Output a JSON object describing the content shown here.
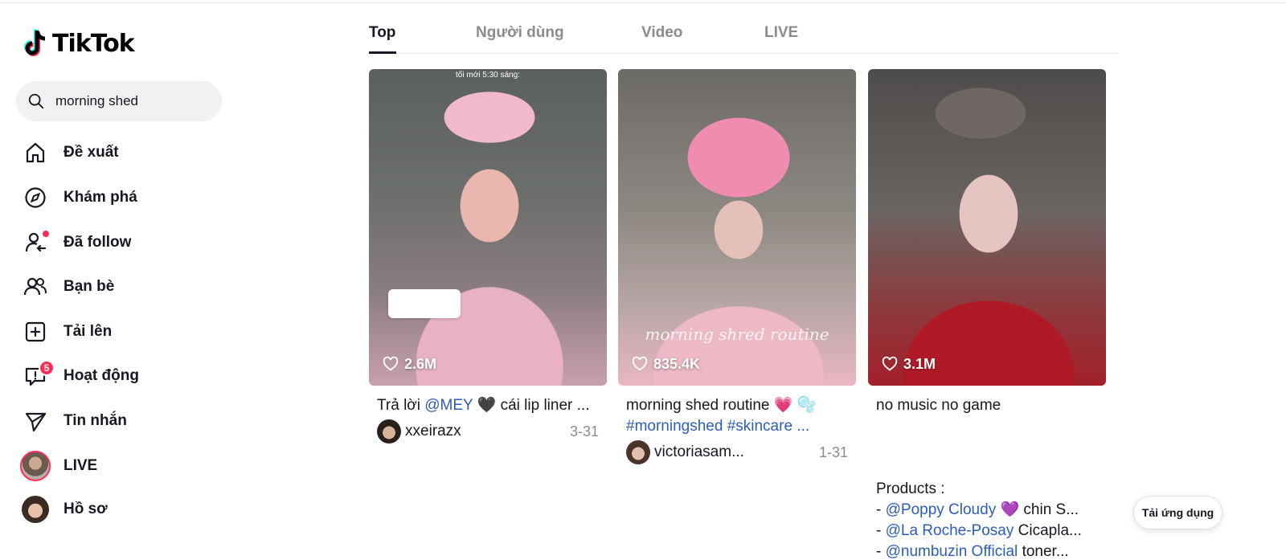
{
  "app": {
    "logo_text": "TikTok",
    "accent": "#fe2c55",
    "link_color": "#2b5db9"
  },
  "search": {
    "value": "morning shed"
  },
  "sidebar": {
    "items": [
      {
        "label": "Đề xuất",
        "icon": "home-icon"
      },
      {
        "label": "Khám phá",
        "icon": "compass-icon"
      },
      {
        "label": "Đã follow",
        "icon": "following-icon"
      },
      {
        "label": "Bạn bè",
        "icon": "friends-icon"
      },
      {
        "label": "Tải lên",
        "icon": "upload-icon"
      },
      {
        "label": "Hoạt động",
        "icon": "activity-icon",
        "badge": "5"
      },
      {
        "label": "Tin nhắn",
        "icon": "messages-icon"
      },
      {
        "label": "LIVE",
        "icon": "live-avatar"
      },
      {
        "label": "Hồ sơ",
        "icon": "profile-avatar"
      }
    ]
  },
  "tabs": [
    {
      "label": "Top",
      "active": true
    },
    {
      "label": "Người dùng",
      "active": false
    },
    {
      "label": "Video",
      "active": false
    },
    {
      "label": "LIVE",
      "active": false
    }
  ],
  "videos": [
    {
      "likes": "2.6M",
      "caption_prefix": "Trả lời ",
      "caption_mention": "@MEY",
      "caption_rest": " 🖤 cái lip liner ...",
      "author": "xxeirazx",
      "date": "3-31",
      "overlay_text": "tối mới 5:30 sáng:"
    },
    {
      "likes": "835.4K",
      "caption_line1": "morning shed routine 💗 🫧",
      "caption_line2": "#morningshed #skincare ...",
      "author": "victoriasam...",
      "date": "1-31",
      "overlay_text": "morning shred routine"
    },
    {
      "likes": "3.1M",
      "caption": "no music no game",
      "products_heading": "Products :",
      "products": [
        {
          "prefix": "- ",
          "mention": "@Poppy Cloudy",
          "rest": " 💜 chin S..."
        },
        {
          "prefix": "- ",
          "mention": "@La Roche-Posay",
          "rest": " Cicapla..."
        },
        {
          "prefix": "- ",
          "mention": "@numbuzin Official",
          "rest": " toner..."
        }
      ]
    }
  ],
  "download_app": "Tải ứng dụng"
}
